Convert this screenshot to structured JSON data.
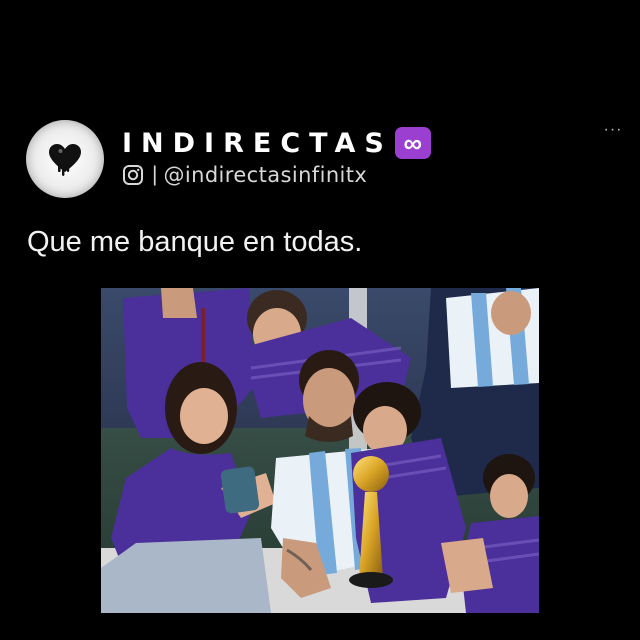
{
  "profile": {
    "name": "INDIRECTAS",
    "badge_symbol": "∞",
    "separator": "|",
    "handle": "@indirectasinfinitx",
    "avatar_icon": "dripping-heart-icon",
    "platform_icon": "instagram-icon"
  },
  "menu": {
    "more_label": "···"
  },
  "post": {
    "text": "Que me banque en todas."
  },
  "photo": {
    "subject": "trophy-celebration-photo"
  },
  "colors": {
    "background": "#000000",
    "badge": "#9b3fd0",
    "text": "#ffffff",
    "secondary_text": "#d8d8d8",
    "jersey_purple": "#4b2f9a",
    "jersey_blue": "#75aadb"
  }
}
